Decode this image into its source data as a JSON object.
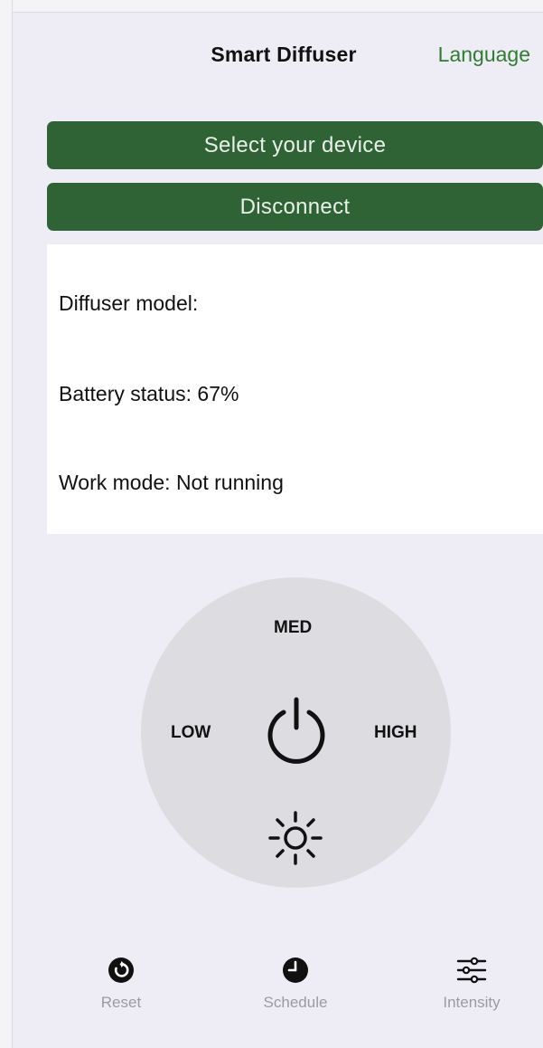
{
  "header": {
    "title": "Smart Diffuser",
    "language_label": "Language"
  },
  "actions": {
    "select_device_label": "Select your device",
    "disconnect_label": "Disconnect"
  },
  "device_info": {
    "model_text": "Diffuser model:",
    "battery_text": "Battery status: 67%",
    "work_mode_text": "Work mode: Not running"
  },
  "dial": {
    "med_label": "MED",
    "low_label": "LOW",
    "high_label": "HIGH",
    "center_icon": "power-icon",
    "bottom_icon": "light-icon"
  },
  "tab_bar": {
    "items": [
      {
        "label": "Reset",
        "icon": "reset-icon"
      },
      {
        "label": "Schedule",
        "icon": "clock-icon"
      },
      {
        "label": "Intensity",
        "icon": "sliders-icon"
      }
    ]
  },
  "colors": {
    "accent_green": "#2f6336",
    "link_green": "#2e7d32",
    "background": "#eeedf5",
    "dial_gray": "#dcdce1",
    "tab_label_gray": "#9b9b9f"
  }
}
